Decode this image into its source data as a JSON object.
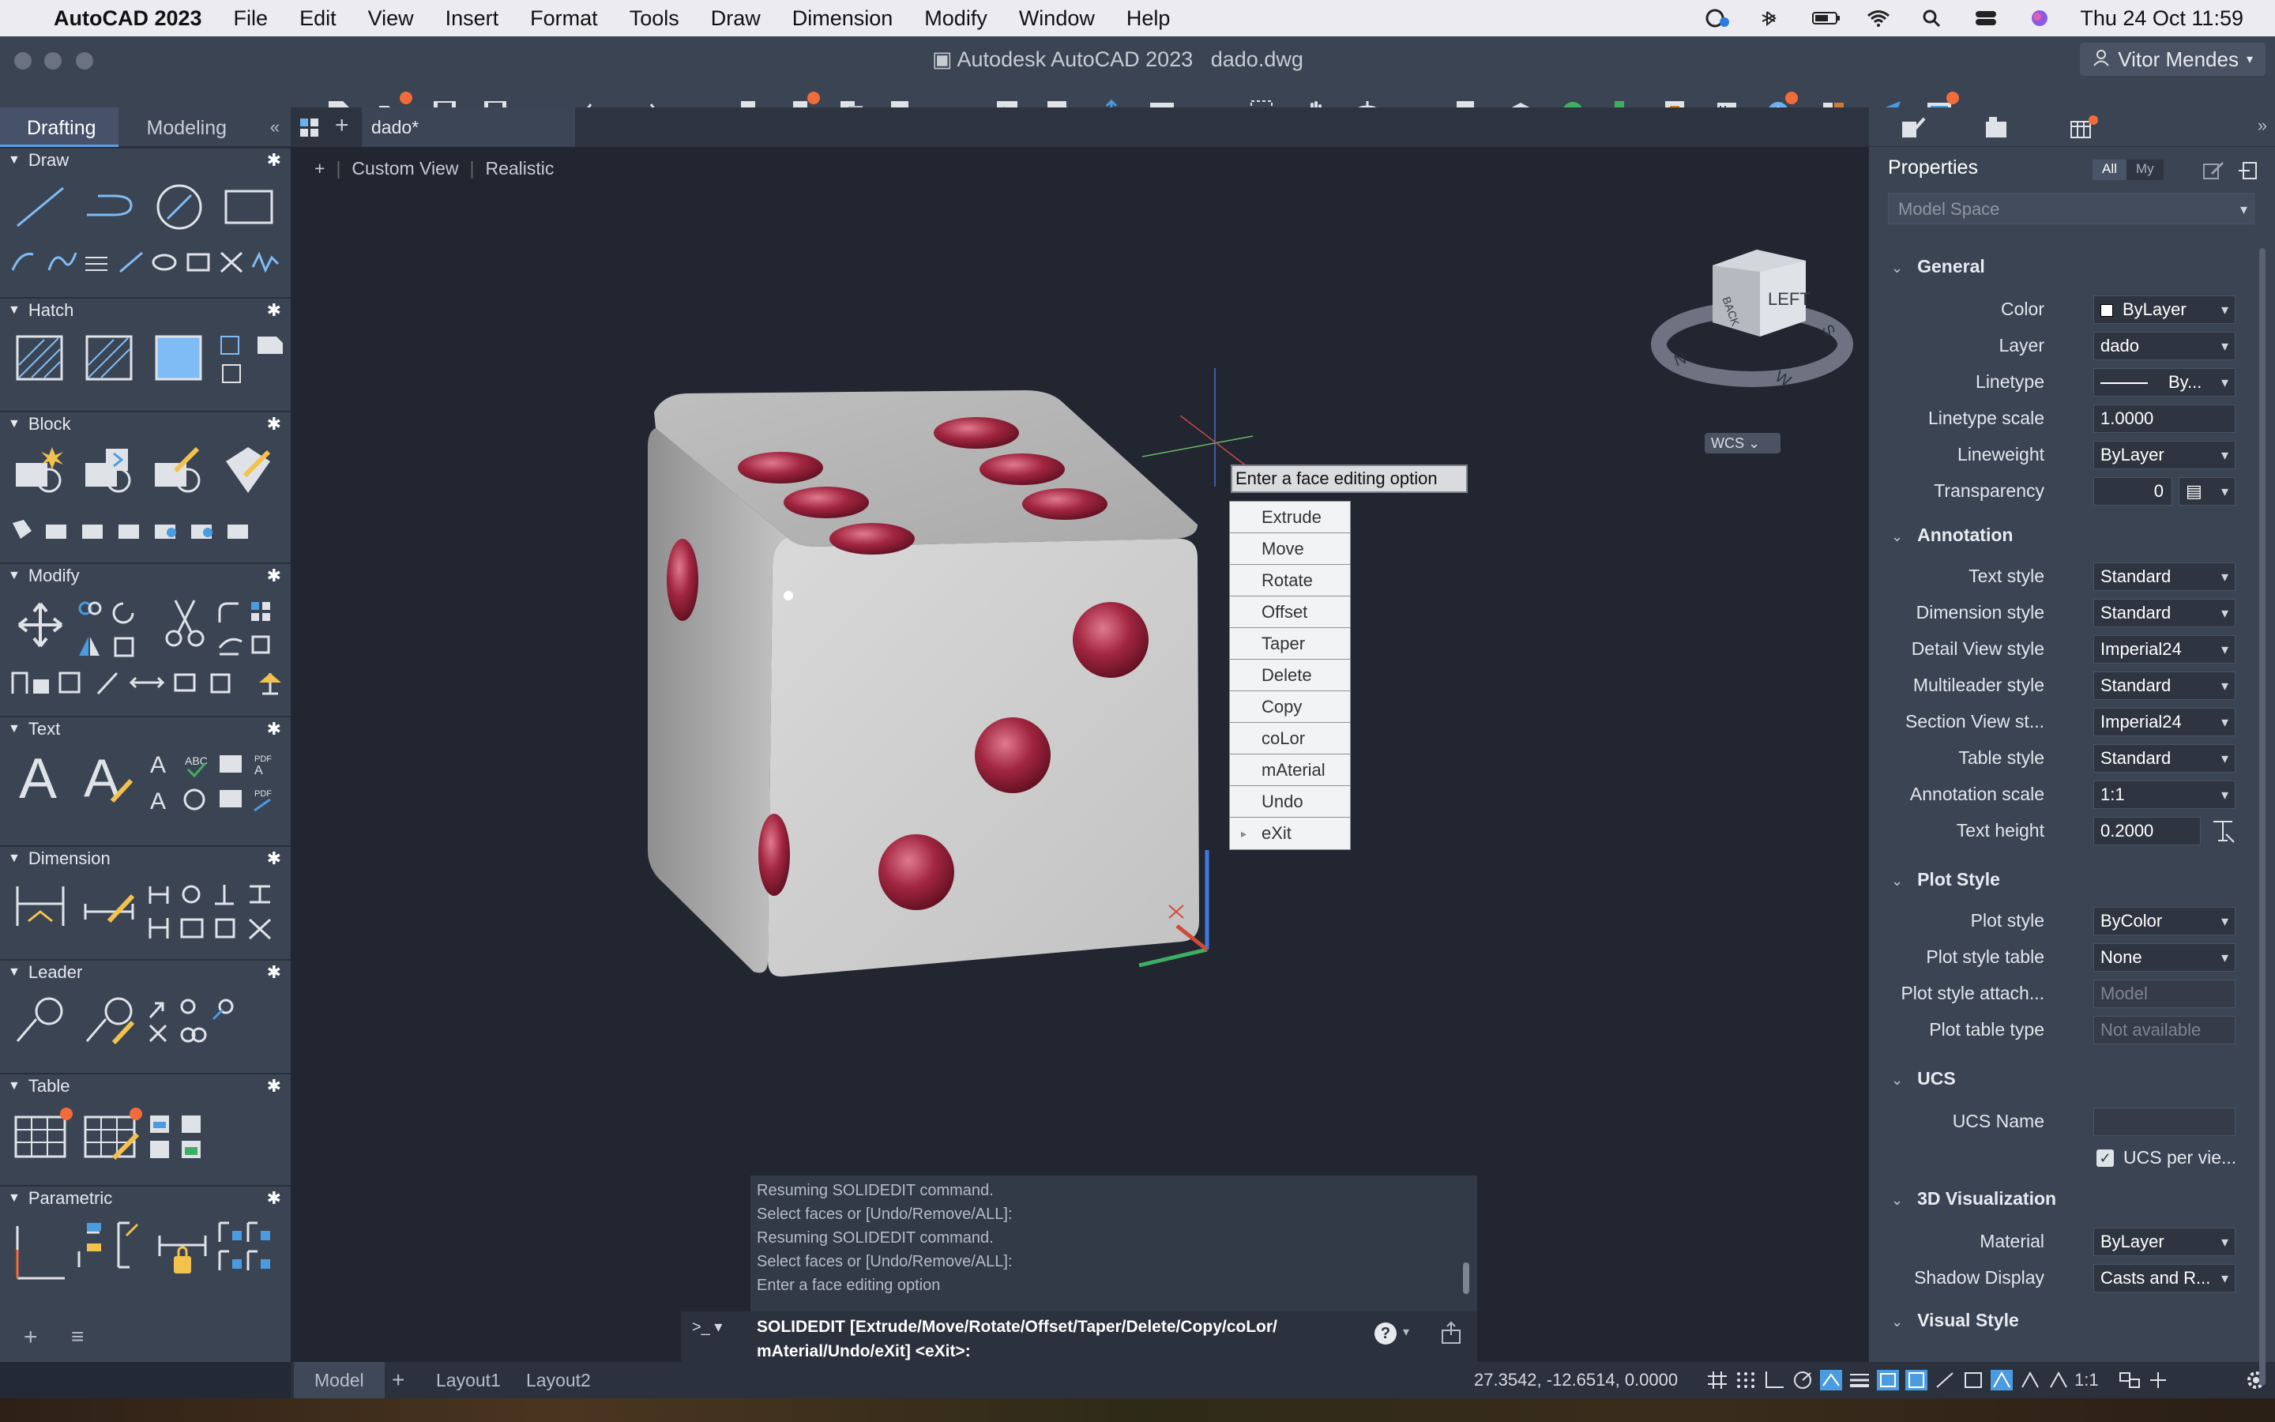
{
  "menubar": {
    "app_name": "AutoCAD 2023",
    "items": [
      "File",
      "Edit",
      "View",
      "Insert",
      "Format",
      "Tools",
      "Draw",
      "Dimension",
      "Modify",
      "Window",
      "Help"
    ],
    "clock": "Thu 24 Oct  11:59"
  },
  "window": {
    "title": "Autodesk AutoCAD 2023",
    "file": "dado.dwg",
    "user": "Vitor Mendes"
  },
  "left_palette": {
    "tabs": [
      "Drafting",
      "Modeling"
    ],
    "active_tab": "Drafting",
    "sections": [
      "Draw",
      "Hatch",
      "Block",
      "Modify",
      "Text",
      "Dimension",
      "Leader",
      "Table",
      "Parametric"
    ]
  },
  "document": {
    "tab": "dado*",
    "view_labels": [
      "+",
      "Custom View",
      "Realistic"
    ],
    "viewcube_face": "LEFT",
    "viewcube_back": "BACK",
    "compass": [
      "N",
      "W",
      "S"
    ],
    "wcs": "WCS"
  },
  "face_edit": {
    "prompt": "Enter a face editing option",
    "options": [
      "Extrude",
      "Move",
      "Rotate",
      "Offset",
      "Taper",
      "Delete",
      "Copy",
      "coLor",
      "mAterial",
      "Undo",
      "eXit"
    ]
  },
  "command": {
    "history": [
      "Resuming SOLIDEDIT command.",
      "Select faces or [Undo/Remove/ALL]:",
      "Resuming SOLIDEDIT command.",
      "Select faces or [Undo/Remove/ALL]:",
      "Enter a face editing option"
    ],
    "current_line1": "SOLIDEDIT [Extrude/Move/Rotate/Offset/Taper/Delete/Copy/coLor/",
    "current_line2": "mAterial/Undo/eXit] <eXit>:",
    "prompt_symbol": ">_"
  },
  "layouts": {
    "tabs": [
      "Model",
      "Layout1",
      "Layout2"
    ],
    "active": "Model",
    "coords": "27.3542, -12.6514, 0.0000",
    "scale": "1:1"
  },
  "properties": {
    "title": "Properties",
    "filters": [
      "All",
      "My"
    ],
    "scope": "Model Space",
    "general_header": "General",
    "color_label": "Color",
    "color_value": "ByLayer",
    "layer_label": "Layer",
    "layer_value": "dado",
    "linetype_label": "Linetype",
    "linetype_value": "By...",
    "linetype_scale_label": "Linetype scale",
    "linetype_scale_value": "1.0000",
    "lineweight_label": "Lineweight",
    "lineweight_value": "ByLayer",
    "transparency_label": "Transparency",
    "transparency_value": "0",
    "annotation_header": "Annotation",
    "text_style_label": "Text style",
    "text_style_value": "Standard",
    "dimension_style_label": "Dimension style",
    "dimension_style_value": "Standard",
    "detail_view_label": "Detail View style",
    "detail_view_value": "Imperial24",
    "multileader_label": "Multileader style",
    "multileader_value": "Standard",
    "section_view_label": "Section View st...",
    "section_view_value": "Imperial24",
    "table_style_label": "Table style",
    "table_style_value": "Standard",
    "annotation_scale_label": "Annotation scale",
    "annotation_scale_value": "1:1",
    "text_height_label": "Text height",
    "text_height_value": "0.2000",
    "plot_header": "Plot Style",
    "plot_style_label": "Plot style",
    "plot_style_value": "ByColor",
    "plot_table_label": "Plot style table",
    "plot_table_value": "None",
    "plot_attach_label": "Plot style attach...",
    "plot_attach_value": "Model",
    "plot_type_label": "Plot table type",
    "plot_type_value": "Not available",
    "ucs_header": "UCS",
    "ucs_name_label": "UCS Name",
    "ucs_name_value": "",
    "ucs_per_view": "UCS per vie...",
    "viz_header": "3D Visualization",
    "material_label": "Material",
    "material_value": "ByLayer",
    "shadow_label": "Shadow Display",
    "shadow_value": "Casts and R...",
    "visual_header": "Visual Style"
  },
  "colors": {
    "accent": "#f26b3a",
    "panel": "#3b4453",
    "canvas": "#212630",
    "die_body": "#c9c9c9",
    "pip": "#8f1c34"
  }
}
